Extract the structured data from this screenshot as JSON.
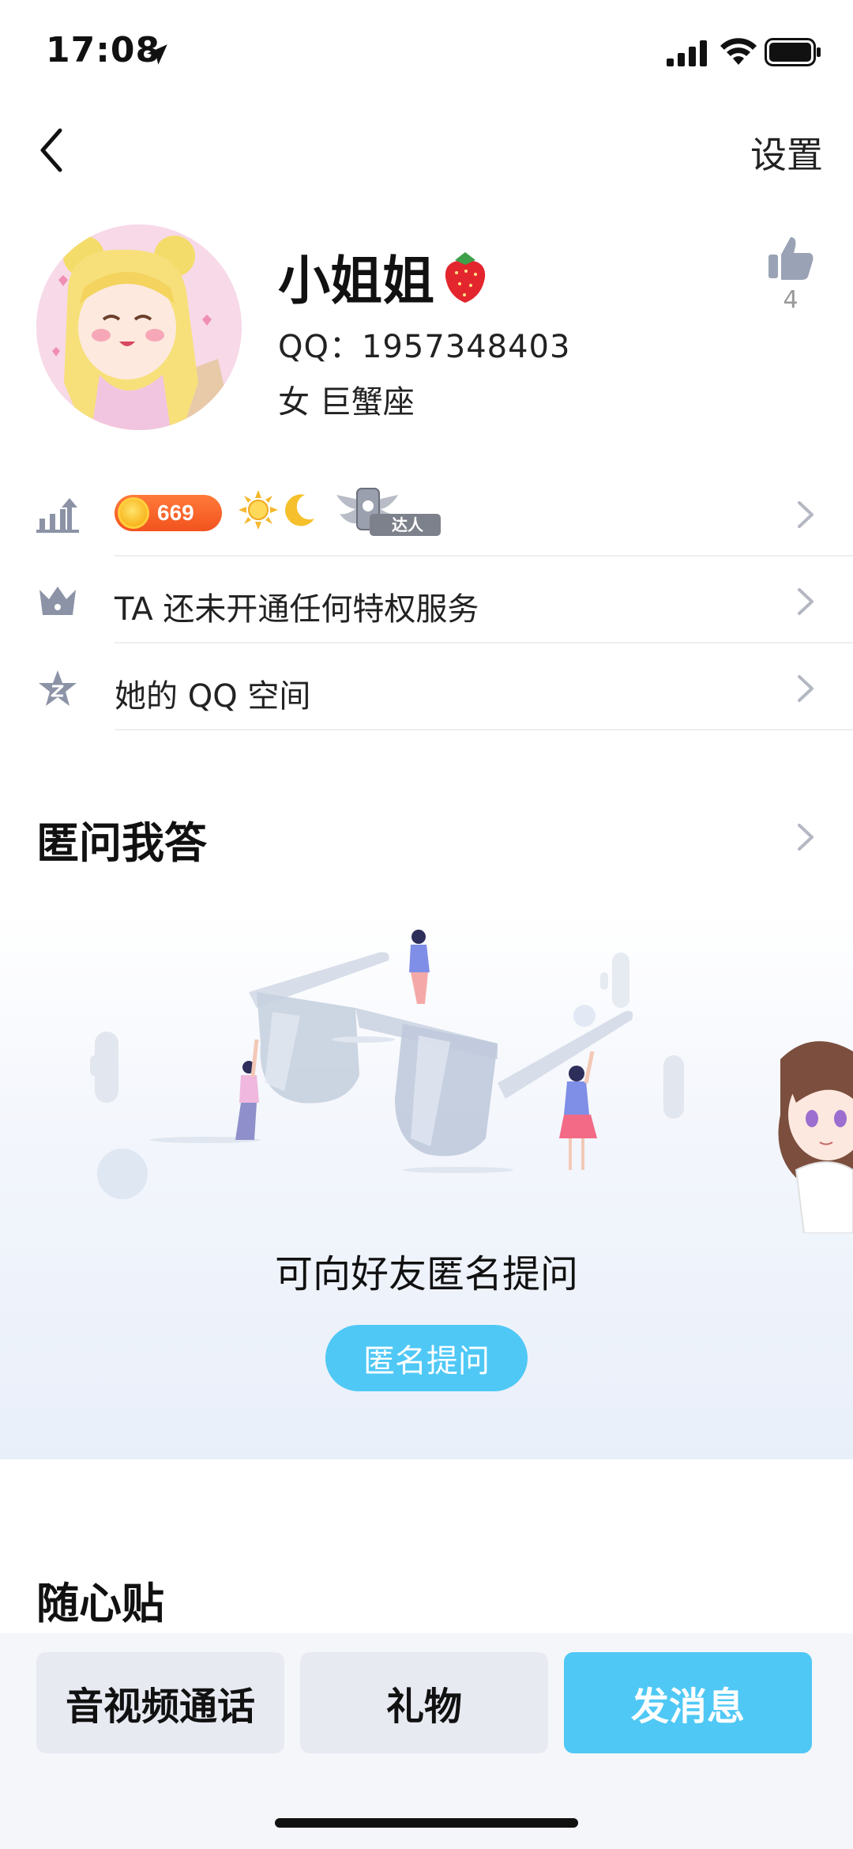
{
  "status_bar": {
    "time": "17:08"
  },
  "nav": {
    "settings_label": "设置"
  },
  "profile": {
    "nickname": "小姐姐",
    "qq_line": "QQ：1957348403",
    "gender_sign": "女   巨蟹座",
    "like_count": "4"
  },
  "level_row": {
    "coin_value": "669",
    "master_label": "达人"
  },
  "privilege_row": {
    "label": "TA 还未开通任何特权服务"
  },
  "qzone_row": {
    "label": "她的 QQ 空间"
  },
  "qa_section": {
    "title": "匿问我答",
    "prompt_text": "可向好友匿名提问",
    "ask_button_label": "匿名提问"
  },
  "notes_section": {
    "title": "随心贴"
  },
  "actions": {
    "call_label": "音视频通话",
    "gift_label": "礼物",
    "message_label": "发消息"
  },
  "colors": {
    "accent": "#4fc8f5",
    "coin": "#f2531e",
    "secondary_button": "#e8eaf2"
  },
  "icons": [
    "location-arrow-icon",
    "signal-icon",
    "wifi-icon",
    "battery-icon",
    "back-arrow-icon",
    "thumbs-up-icon",
    "level-up-icon",
    "crown-icon",
    "qzone-star-icon",
    "chevron-right-icon",
    "strawberry-icon"
  ]
}
